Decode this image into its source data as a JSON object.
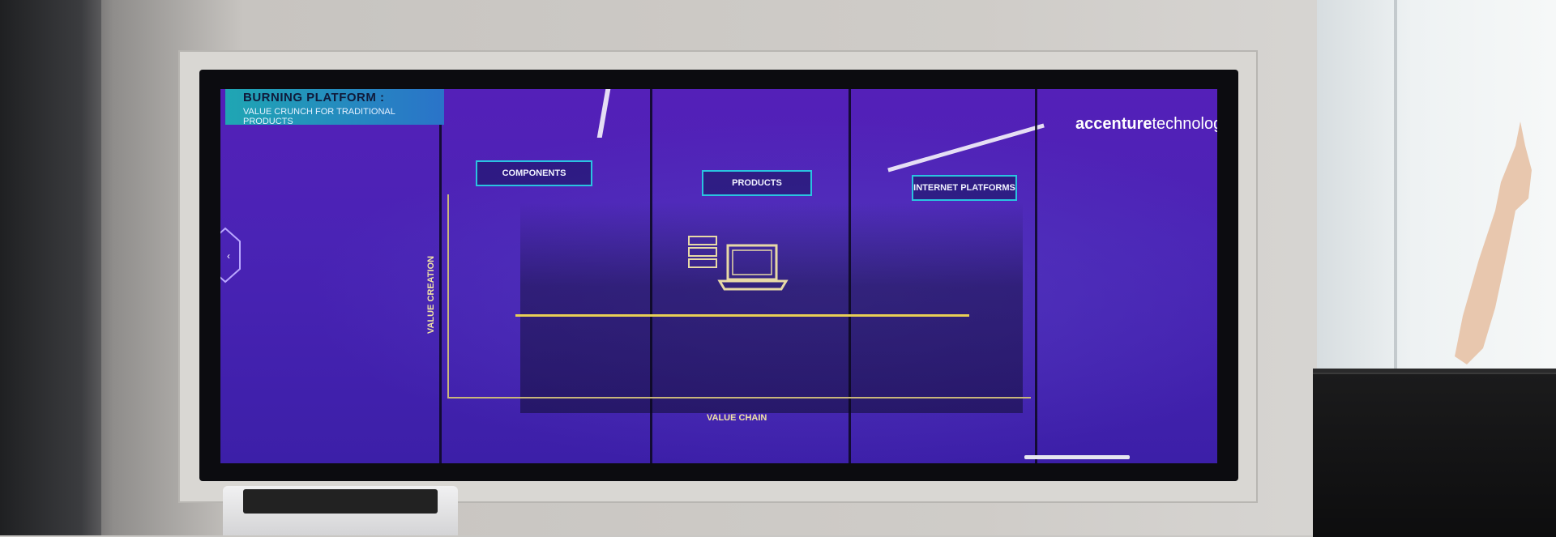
{
  "scene": "photo",
  "screen": {
    "title": "BURNING PLATFORM :",
    "subtitle": "VALUE CRUNCH FOR TRADITIONAL PRODUCTS",
    "labels": {
      "components": "COMPONENTS",
      "products": "PRODUCTS",
      "internet_platforms": "INTERNET PLATFORMS"
    },
    "axis": {
      "y": "VALUE CREATION",
      "x": "VALUE CHAIN"
    },
    "logo": {
      "bold": "accenture",
      "regular": "technology"
    }
  },
  "colors": {
    "screen": "#4a23b5",
    "banner": "#1fa6b3",
    "box_border": "#2ac3e0",
    "accent_line": "#e8cf55"
  },
  "icons": [
    "laptop-icon",
    "server-icon",
    "hexagon-nav-icon"
  ]
}
